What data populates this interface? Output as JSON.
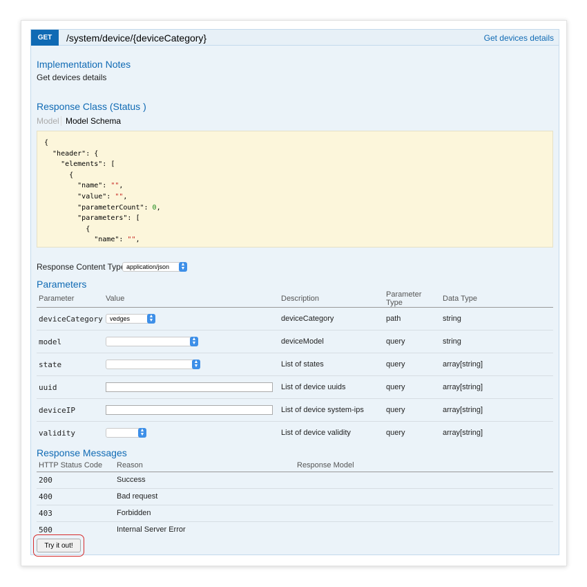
{
  "operation": {
    "method": "GET",
    "path": "/system/device/{deviceCategory}",
    "summary": "Get devices details"
  },
  "implementation_notes": {
    "heading": "Implementation Notes",
    "text": "Get devices details"
  },
  "response_class": {
    "heading": "Response Class (Status )",
    "tab_model": "Model",
    "tab_schema": "Model Schema"
  },
  "response_content_type": {
    "label": "Response Content Type",
    "value": "application/json"
  },
  "parameters": {
    "heading": "Parameters",
    "columns": [
      "Parameter",
      "Value",
      "Description",
      "Parameter Type",
      "Data Type"
    ],
    "rows": [
      {
        "name": "deviceCategory",
        "value": "vedges",
        "description": "deviceCategory",
        "param_type": "path",
        "data_type": "string"
      },
      {
        "name": "model",
        "value": "",
        "description": "deviceModel",
        "param_type": "query",
        "data_type": "string"
      },
      {
        "name": "state",
        "value": "",
        "description": "List of states",
        "param_type": "query",
        "data_type": "array[string]"
      },
      {
        "name": "uuid",
        "value": "",
        "description": "List of device uuids",
        "param_type": "query",
        "data_type": "array[string]"
      },
      {
        "name": "deviceIP",
        "value": "",
        "description": "List of device system-ips",
        "param_type": "query",
        "data_type": "array[string]"
      },
      {
        "name": "validity",
        "value": "",
        "description": "List of device validity",
        "param_type": "query",
        "data_type": "array[string]"
      }
    ]
  },
  "response_messages": {
    "heading": "Response Messages",
    "columns": [
      "HTTP Status Code",
      "Reason",
      "Response Model"
    ],
    "rows": [
      {
        "code": "200",
        "reason": "Success"
      },
      {
        "code": "400",
        "reason": "Bad request"
      },
      {
        "code": "403",
        "reason": "Forbidden"
      },
      {
        "code": "500",
        "reason": "Internal Server Error"
      }
    ]
  },
  "try_button": "Try it out!",
  "colors": {
    "accent": "#0f6ab4",
    "panel_bg": "#ebf3f9",
    "snippet_bg": "#fcf6db",
    "highlight": "#d62b2b"
  }
}
